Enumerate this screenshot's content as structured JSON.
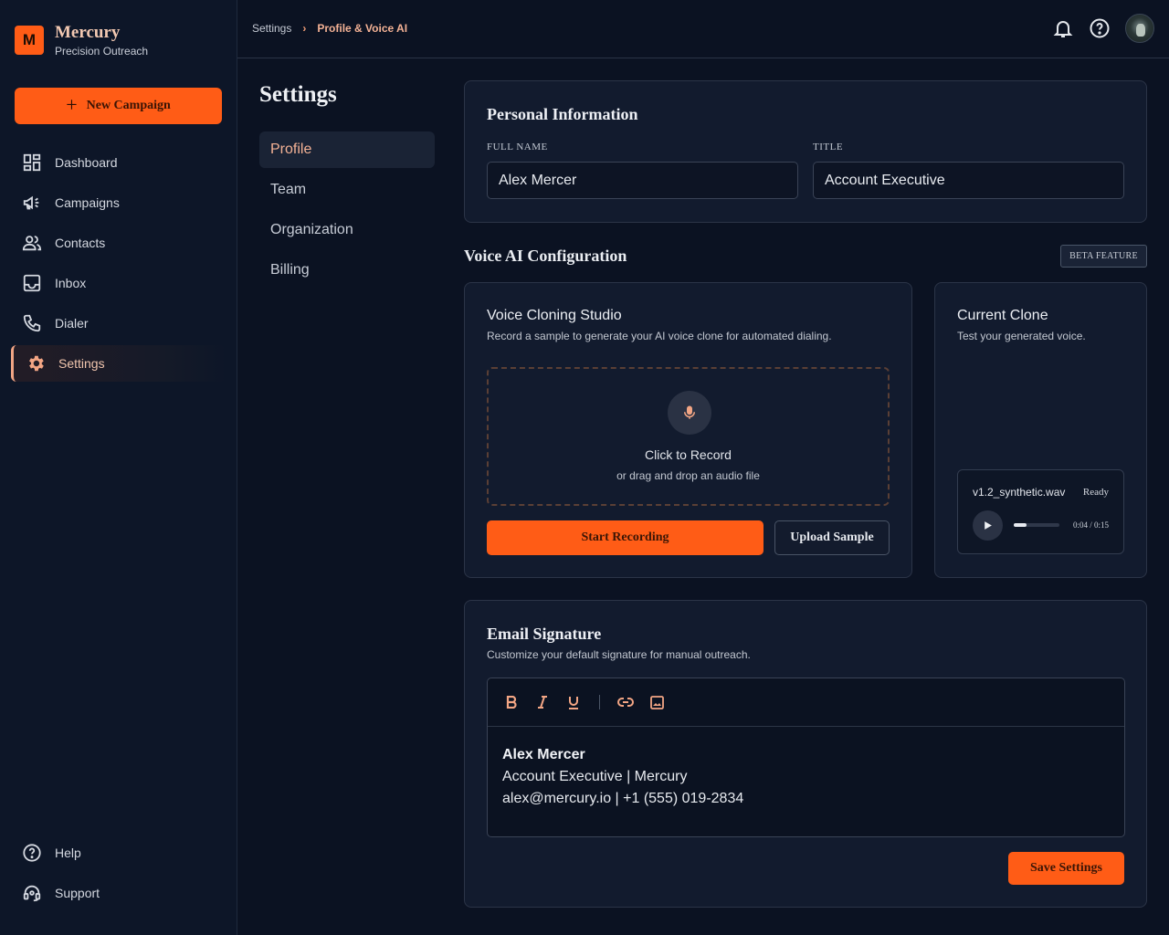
{
  "brand": {
    "logo_letter": "M",
    "name": "Mercury",
    "tagline": "Precision Outreach"
  },
  "sidebar": {
    "new_campaign_label": "New Campaign",
    "items": [
      {
        "label": "Dashboard",
        "icon": "dashboard-icon"
      },
      {
        "label": "Campaigns",
        "icon": "megaphone-icon"
      },
      {
        "label": "Contacts",
        "icon": "people-icon"
      },
      {
        "label": "Inbox",
        "icon": "inbox-icon"
      },
      {
        "label": "Dialer",
        "icon": "phone-icon"
      },
      {
        "label": "Settings",
        "icon": "gear-icon",
        "active": true
      }
    ],
    "bottom_items": [
      {
        "label": "Help",
        "icon": "help-icon"
      },
      {
        "label": "Support",
        "icon": "headset-icon"
      }
    ]
  },
  "breadcrumb": {
    "parent": "Settings",
    "current": "Profile & Voice AI"
  },
  "settings": {
    "title": "Settings",
    "subnav": [
      {
        "label": "Profile",
        "active": true
      },
      {
        "label": "Team"
      },
      {
        "label": "Organization"
      },
      {
        "label": "Billing"
      }
    ]
  },
  "personal_info": {
    "title": "Personal Information",
    "full_name_label": "FULL NAME",
    "full_name_value": "Alex Mercer",
    "title_label": "TITLE",
    "title_value": "Account Executive"
  },
  "voice_ai": {
    "section_title": "Voice AI Configuration",
    "badge": "BETA FEATURE",
    "studio": {
      "title": "Voice Cloning Studio",
      "description": "Record a sample to generate your AI voice clone for automated dialing.",
      "drop_main": "Click to Record",
      "drop_sub": "or drag and drop an audio file",
      "start_recording": "Start Recording",
      "upload_sample": "Upload Sample"
    },
    "current_clone": {
      "title": "Current Clone",
      "description": "Test your generated voice.",
      "file_name": "v1.2_synthetic.wav",
      "status": "Ready",
      "time": "0:04 / 0:15",
      "progress": 0.27
    }
  },
  "email_signature": {
    "title": "Email Signature",
    "description": "Customize your default signature for manual outreach.",
    "toolbar": [
      "bold-icon",
      "italic-icon",
      "underline-icon",
      "link-icon",
      "image-icon"
    ],
    "name": "Alex Mercer",
    "line2": "Account Executive | Mercury",
    "line3": "alex@mercury.io | +1 (555) 019-2834",
    "save_label": "Save Settings"
  },
  "colors": {
    "accent": "#ff5c16",
    "accent_text": "#f4b295",
    "background": "#0b1222",
    "card": "#121b2e"
  }
}
